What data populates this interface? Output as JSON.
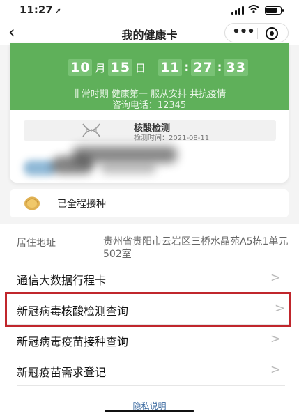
{
  "status": {
    "time": "11:27",
    "location_arrow": "➚"
  },
  "nav": {
    "back": "‹",
    "title": "我的健康卡",
    "more": "•••"
  },
  "card": {
    "month": "10",
    "month_unit": "月",
    "day": "15",
    "day_unit": "日",
    "hour": "11",
    "minute": "27",
    "second": "33",
    "slogan": "非常时期 健康第一 服从安排 共抗疫情",
    "hotline": "咨询电话：12345",
    "test": {
      "title": "核酸检测",
      "time": "检测时间：2021-08-11"
    }
  },
  "vaccination": {
    "label": "已全程接种"
  },
  "address": {
    "label": "居住地址",
    "value": "贵州省贵阳市云岩区三桥水晶苑A5栋1单元502室"
  },
  "menu": [
    {
      "label": "通信大数据行程卡"
    },
    {
      "label": "新冠病毒核酸检测查询"
    },
    {
      "label": "新冠病毒疫苗接种查询"
    },
    {
      "label": "新冠疫苗需求登记"
    }
  ],
  "footer": {
    "privacy": "隐私说明"
  },
  "colors": {
    "card_green": "#5fb05a",
    "highlight": "#c0262c"
  }
}
